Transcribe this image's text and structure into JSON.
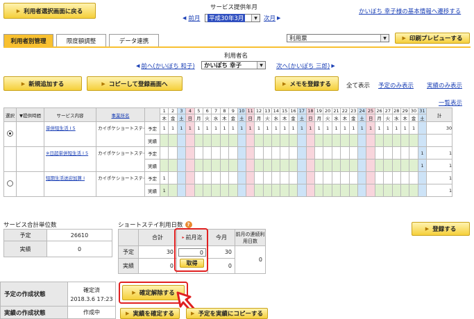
{
  "top": {
    "back_button": "利用者選択画面に戻る",
    "service_month_label": "サービス提供年月",
    "prev_month": "前月",
    "next_month": "次月",
    "month_value": "平成30年3月",
    "basic_info_link": "かいぼち 幸子様の基本情報へ遷移する"
  },
  "tabs": [
    "利用者別管理",
    "限度額調整",
    "データ連携"
  ],
  "toolbar": {
    "form_select": "利用票",
    "print_preview": "印刷プレビューする"
  },
  "user_nav": {
    "label": "利用者名",
    "prev": "前へ(かいぼち 和子)",
    "current": "かいぽち 幸子",
    "next": "次へ(かいぽち 三郎)"
  },
  "actions": {
    "new_add": "新規追加する",
    "copy_register": "コピーして登録画面へ",
    "memo": "メモを登録する",
    "show_all": "全て表示",
    "show_plan": "予定のみ表示",
    "show_actual": "実績のみ表示",
    "list_view": "一覧表示"
  },
  "schedule": {
    "headers": {
      "select": "選択",
      "time": "▼提供時間",
      "content": "サービス内容",
      "provider": "事業所名",
      "total": "計"
    },
    "days": [
      "1",
      "2",
      "3",
      "4",
      "5",
      "6",
      "7",
      "8",
      "9",
      "10",
      "11",
      "12",
      "13",
      "14",
      "15",
      "16",
      "17",
      "18",
      "19",
      "20",
      "21",
      "22",
      "23",
      "24",
      "25",
      "26",
      "27",
      "28",
      "29",
      "30",
      "31"
    ],
    "weekdays": [
      "木",
      "金",
      "土",
      "日",
      "月",
      "火",
      "水",
      "木",
      "金",
      "土",
      "日",
      "月",
      "火",
      "水",
      "木",
      "金",
      "土",
      "日",
      "月",
      "火",
      "水",
      "木",
      "金",
      "土",
      "日",
      "月",
      "火",
      "水",
      "木",
      "金",
      "土"
    ],
    "plan_label": "予定",
    "actual_label": "実績",
    "rows": [
      {
        "service": "単併短生活 I 5",
        "provider": "カイポケショートステイ",
        "plan_total": "30",
        "actual_total": "",
        "plan": [
          "1",
          "1",
          "1",
          "1",
          "1",
          "1",
          "1",
          "1",
          "1",
          "1",
          "1",
          "1",
          "1",
          "1",
          "1",
          "1",
          "1",
          "1",
          "1",
          "1",
          "1",
          "1",
          "1",
          "1",
          "1",
          "1",
          "1",
          "1",
          "1",
          "1",
          ""
        ],
        "actual": [
          "",
          "",
          "",
          "",
          "",
          "",
          "",
          "",
          "",
          "",
          "",
          "",
          "",
          "",
          "",
          "",
          "",
          "",
          "",
          "",
          "",
          "",
          "",
          "",
          "",
          "",
          "",
          "",
          "",
          "",
          ""
        ]
      },
      {
        "service": "※日超単併短生活 I 5",
        "provider": "カイポケショートステイ",
        "plan_total": "1",
        "actual_total": "1",
        "plan": [
          "",
          "",
          "",
          "",
          "",
          "",
          "",
          "",
          "",
          "",
          "",
          "",
          "",
          "",
          "",
          "",
          "",
          "",
          "",
          "",
          "",
          "",
          "",
          "",
          "",
          "",
          "",
          "",
          "",
          "",
          "1"
        ],
        "actual": [
          "",
          "",
          "",
          "",
          "",
          "",
          "",
          "",
          "",
          "",
          "",
          "",
          "",
          "",
          "",
          "",
          "",
          "",
          "",
          "",
          "",
          "",
          "",
          "",
          "",
          "",
          "",
          "",
          "",
          "",
          "1"
        ]
      },
      {
        "service": "短期生活送迎加算 I",
        "provider": "カイポケショートステイ",
        "plan_total": "1",
        "actual_total": "1",
        "plan": [
          "1",
          "",
          "",
          "",
          "",
          "",
          "",
          "",
          "",
          "",
          "",
          "",
          "",
          "",
          "",
          "",
          "",
          "",
          "",
          "",
          "",
          "",
          "",
          "",
          "",
          "",
          "",
          "",
          "",
          "",
          ""
        ],
        "actual": [
          "1",
          "",
          "",
          "",
          "",
          "",
          "",
          "",
          "",
          "",
          "",
          "",
          "",
          "",
          "",
          "",
          "",
          "",
          "",
          "",
          "",
          "",
          "",
          "",
          "",
          "",
          "",
          "",
          "",
          "",
          ""
        ]
      }
    ]
  },
  "summary": {
    "title": "サービス合計単位数",
    "plan_label": "予定",
    "plan_value": "26610",
    "actual_label": "実績",
    "actual_value": "0"
  },
  "shortstay": {
    "title": "ショートステイ利用日数",
    "col_total": "合計",
    "col_prev": "前月迄",
    "col_this": "今月",
    "col_consec": "前月の連続利用日数",
    "plan_label": "予定",
    "actual_label": "実績",
    "plan_total": "30",
    "prev_value": "0",
    "plan_this": "30",
    "actual_total": "0",
    "actual_this": "0",
    "consec": "0",
    "fetch_button": "取得"
  },
  "register_button": "登録する",
  "status": {
    "plan_label": "予定の作成状態",
    "plan_status": "確定済",
    "plan_date": "2018.3.6 17:23",
    "unconfirm_button": "確定解除する",
    "actual_label": "実績の作成状態",
    "actual_status": "作成中",
    "confirm_button": "実績を確定する",
    "copy_button": "予定を実績にコピーする"
  },
  "colors": {
    "accent": "#f8c030",
    "highlight": "#e02020",
    "link": "#1a3fb5"
  }
}
